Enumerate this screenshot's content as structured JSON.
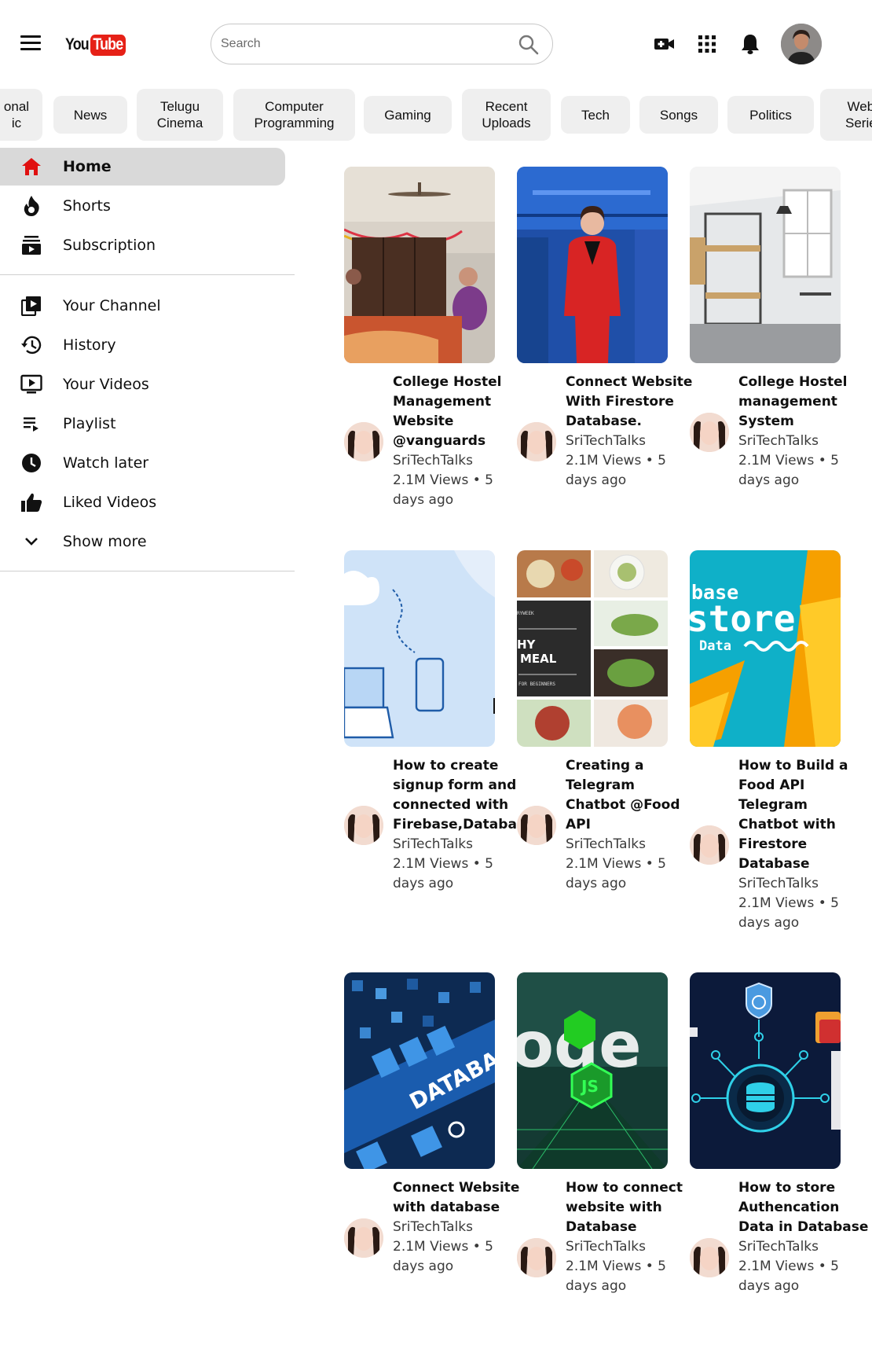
{
  "header": {
    "logo_you": "You",
    "logo_tube": "Tube",
    "search_placeholder": "Search"
  },
  "chips": [
    {
      "label": "onal\nic"
    },
    {
      "label": "News"
    },
    {
      "label": "Telugu\nCinema"
    },
    {
      "label": "Computer\nProgramming"
    },
    {
      "label": "Gaming"
    },
    {
      "label": "Recent\nUploads"
    },
    {
      "label": "Tech"
    },
    {
      "label": "Songs"
    },
    {
      "label": "Politics"
    },
    {
      "label": "Web\nSerie"
    }
  ],
  "sidebar": {
    "items": [
      {
        "label": "Home",
        "icon": "home-icon"
      },
      {
        "label": "Shorts",
        "icon": "shorts-icon"
      },
      {
        "label": "Subscription",
        "icon": "subscriptions-icon"
      },
      {
        "label": "Your Channel",
        "icon": "your-channel-icon"
      },
      {
        "label": "History",
        "icon": "history-icon"
      },
      {
        "label": "Your Videos",
        "icon": "your-videos-icon"
      },
      {
        "label": "Playlist",
        "icon": "playlist-icon"
      },
      {
        "label": "Watch later",
        "icon": "clock-icon"
      },
      {
        "label": "Liked Videos",
        "icon": "thumbs-up-icon"
      },
      {
        "label": "Show more",
        "icon": "chevron-down-icon"
      }
    ]
  },
  "videos": [
    {
      "title": "College Hostel Management Website @vanguards",
      "channel": "SriTechTalks",
      "views": "2.1M Views • 5 days ago"
    },
    {
      "title": "Connect Website With Firestore Database.",
      "channel": "SriTechTalks",
      "views": "2.1M Views • 5 days ago"
    },
    {
      "title": "College Hostel management System",
      "channel": "SriTechTalks",
      "views": "2.1M Views • 5 days ago"
    },
    {
      "title": "How to create signup form and connected with Firebase,Database",
      "channel": "SriTechTalks",
      "views": "2.1M Views • 5 days ago"
    },
    {
      "title": "Creating a Telegram Chatbot @Food API",
      "channel": "SriTechTalks",
      "views": "2.1M Views • 5 days ago"
    },
    {
      "title": "How to Build a Food API Telegram Chatbot with Firestore Database",
      "channel": "SriTechTalks",
      "views": "2.1M Views • 5 days ago"
    },
    {
      "title": "Connect Website with database",
      "channel": "SriTechTalks",
      "views": "2.1M Views • 5 days ago"
    },
    {
      "title": "How to connect website with Database",
      "channel": "SriTechTalks",
      "views": "2.1M Views • 5 days ago"
    },
    {
      "title": "How to store Authencation Data in Database",
      "channel": "SriTechTalks",
      "views": "2.1M Views • 5 days ago"
    }
  ],
  "thumbnail_text": {
    "firestore_line1": "base",
    "firestore_line2": "store",
    "firestore_line3": "Data",
    "meal_line1": "HY",
    "meal_line2": "MEAL",
    "meal_small1": "RYWEEK",
    "meal_small2": "FOR BEGINNERS",
    "database_word": "DATABASE",
    "node_word": "ode",
    "node_js": "JS"
  },
  "colors": {
    "brand_red": "#e62117",
    "active_bg": "#d9d9d9",
    "chip_bg": "#efefef"
  }
}
